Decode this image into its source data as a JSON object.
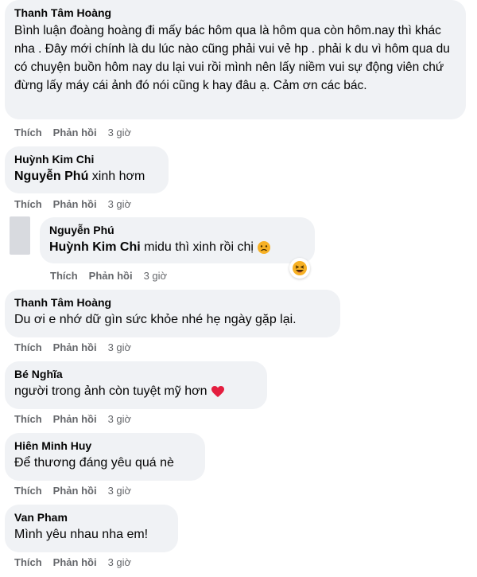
{
  "comments": [
    {
      "author": "Thanh Tâm Hoàng",
      "text": "Bình luận đoàng hoàng đi mấy bác hôm qua là hôm qua còn hôm.nay thì khác nha . Đây mới chính là du lúc nào cũng phải vui vẻ hp . phải k du vì hôm qua du có chuyện buồn hôm nay du lại vui rồi mình nên lấy niềm vui sự động viên chứ đừng lấy máy cái ảnh đó nói cũng k hay đâu ạ. Cảm ơn các bác.",
      "like": "Thích",
      "reply": "Phản hồi",
      "time": "3 giờ"
    },
    {
      "author": "Huỳnh Kim Chi",
      "tag": "Nguyễn Phú",
      "text": "xinh hơm",
      "like": "Thích",
      "reply": "Phản hồi",
      "time": "3 giờ"
    },
    {
      "author": "Nguyễn Phú",
      "tag": "Huỳnh Kim Chi",
      "text": "midu thì xinh rồi chị",
      "like": "Thích",
      "reply": "Phản hồi",
      "time": "3 giờ"
    },
    {
      "author": "Thanh Tâm Hoàng",
      "text": "Du ơi e nhớ dữ gìn sức khỏe nhé hẹ ngày gặp lại.",
      "like": "Thích",
      "reply": "Phản hồi",
      "time": "3 giờ"
    },
    {
      "author": "Bé Nghĩa",
      "text": "người trong ảnh còn tuyệt mỹ hơn",
      "like": "Thích",
      "reply": "Phản hồi",
      "time": "3 giờ"
    },
    {
      "author": "Hiên Minh Huy",
      "text": "Để thương đáng yêu quá nè",
      "like": "Thích",
      "reply": "Phản hồi",
      "time": "3 giờ"
    },
    {
      "author": "Van Pham",
      "text": "Mình yêu nhau nha em!",
      "like": "Thích",
      "reply": "Phản hồi",
      "time": "3 giờ"
    }
  ],
  "icons": {
    "reaction": "laughing-emoji-icon",
    "heart": "red-heart-icon",
    "sad": "sad-emoji-icon"
  },
  "colors": {
    "bubble": "#f0f2f5",
    "meta": "#65676b",
    "heart": "#e41e3f",
    "emoji": "#f7b125"
  }
}
